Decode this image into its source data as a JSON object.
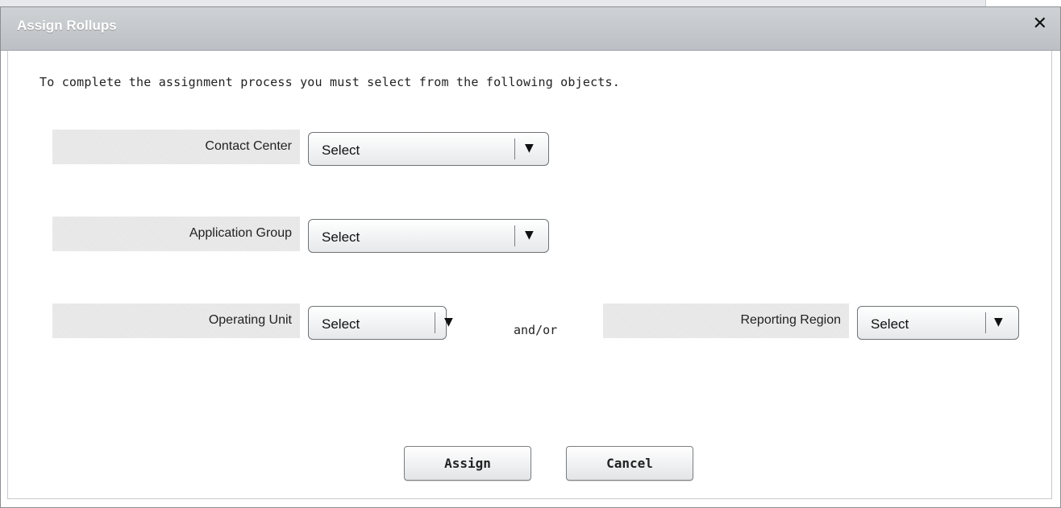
{
  "dialog": {
    "title": "Assign Rollups",
    "close_symbol": "✕",
    "close_icon": "close-icon"
  },
  "instruction": "To complete the assignment process you must select from the following objects.",
  "fields": {
    "contact_center": {
      "label": "Contact Center",
      "value": "Select"
    },
    "application_group": {
      "label": "Application Group",
      "value": "Select"
    },
    "operating_unit": {
      "label": "Operating Unit",
      "value": "Select"
    },
    "reporting_region": {
      "label": "Reporting Region",
      "value": "Select"
    }
  },
  "connector": "and/or",
  "dropdown_arrow": "▼",
  "buttons": {
    "assign": "Assign",
    "cancel": "Cancel"
  }
}
